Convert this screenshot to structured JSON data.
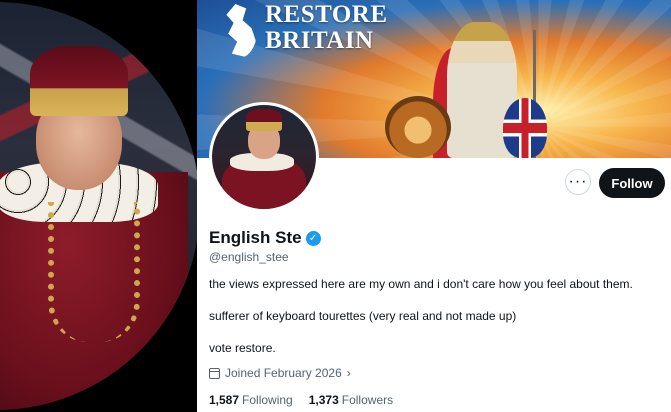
{
  "banner": {
    "title": "RESTORE BRITAIN"
  },
  "profile": {
    "display_name": "English Ste",
    "handle": "@english_stee",
    "verified": true,
    "bio": [
      "the views expressed here are my own and i don't care how you feel about them.",
      "sufferer of keyboard tourettes (very real and not made up)",
      "vote restore."
    ],
    "joined": "Joined February 2026",
    "following_count": "1,587",
    "following_label": "Following",
    "followers_count": "1,373",
    "followers_label": "Followers"
  },
  "actions": {
    "more_label": "···",
    "follow_label": "Follow"
  },
  "colors": {
    "follow_button_bg": "#0f1419",
    "verified_blue": "#1d9bf0",
    "secondary_text": "#536471"
  },
  "icons": {
    "verified": "verified-check-icon",
    "calendar": "calendar-icon",
    "chevron": "chevron-right-icon",
    "more": "more-options-icon"
  }
}
